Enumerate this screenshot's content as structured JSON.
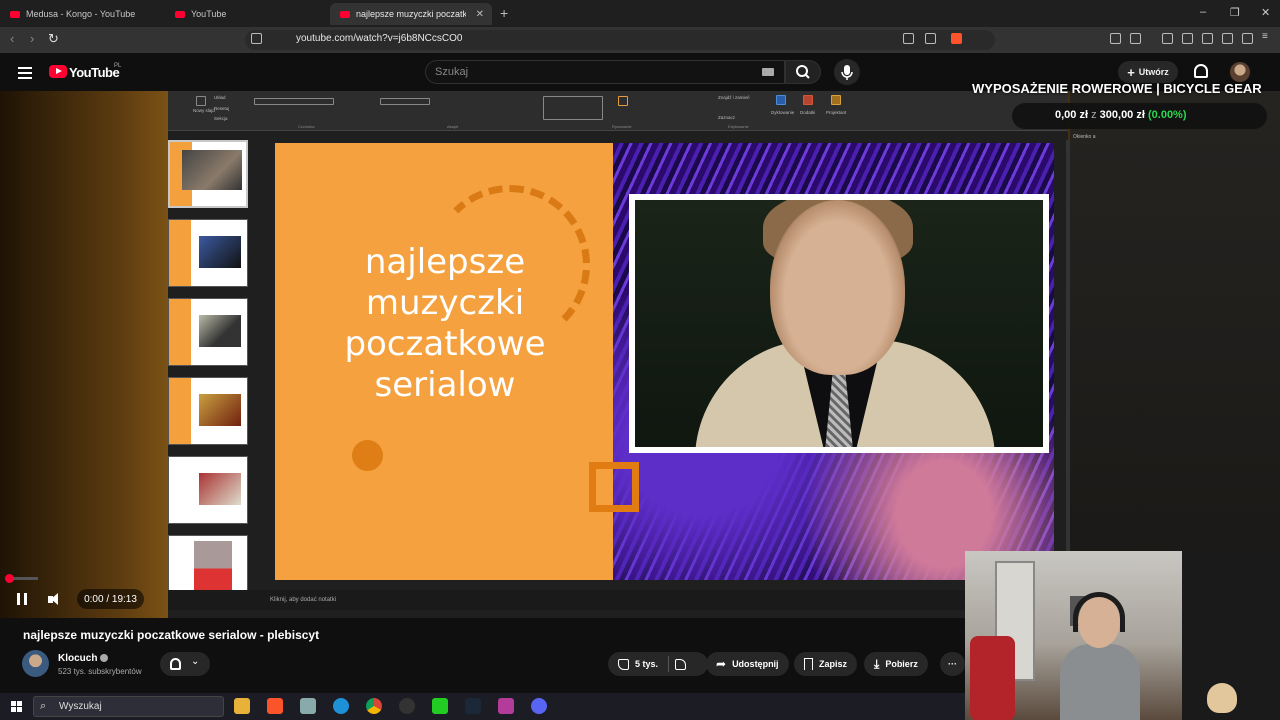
{
  "browser": {
    "tabs": [
      {
        "label": "Medusa - Kongo - YouTube",
        "active": false
      },
      {
        "label": "YouTube",
        "active": false
      },
      {
        "label": "najlepsze muzyczki poczatkow",
        "active": true
      }
    ],
    "url": "youtube.com/watch?v=j6b8NCcsCO0",
    "window_controls": [
      "–",
      "❐",
      "✕"
    ]
  },
  "youtube": {
    "logo": "YouTube",
    "region": "PL",
    "search_placeholder": "Szukaj",
    "create_label": "Utwórz"
  },
  "slides": {
    "ribbon_items": [
      "Układ",
      "Resetuj",
      "Sekcja",
      "Nowy slajd",
      "Czcionka",
      "Akapit",
      "Rysowanie",
      "Edytowanie",
      "Dyktowanie",
      "Dodatki",
      "Projektant",
      "Znajdź i zamień",
      "Zaznacz"
    ],
    "title_lines": [
      "najlepsze",
      "muzyczki",
      "poczatkowe",
      "serialow"
    ],
    "notes_placeholder": "Kliknij, aby dodać notatki",
    "right_panel_label": "Okienko a"
  },
  "overlay": {
    "goal_title": "WYPOSAŻENIE ROWEROWE | BICYCLE GEAR",
    "goal_current": "0,00 zł",
    "goal_sep": "z",
    "goal_target": "300,00 zł",
    "goal_pct": "(0.00%)",
    "goal_progress": 0
  },
  "player": {
    "time": "0:00 / 19:13",
    "progress_fraction": 0
  },
  "video_info": {
    "title": "najlepsze muzyczki poczatkowe serialow - plebiscyt",
    "channel": "Klocuch",
    "subscribers": "523 tys. subskrybentów",
    "likes": "5 tys.",
    "share_label": "Udostępnij",
    "save_label": "Zapisz",
    "download_label": "Pobierz",
    "more_label": "···"
  },
  "taskbar": {
    "search_label": "Wyszukaj"
  },
  "colors": {
    "slide_orange": "#f5a13f",
    "accent_red": "#ff0033",
    "goal_green": "#28d94f"
  }
}
